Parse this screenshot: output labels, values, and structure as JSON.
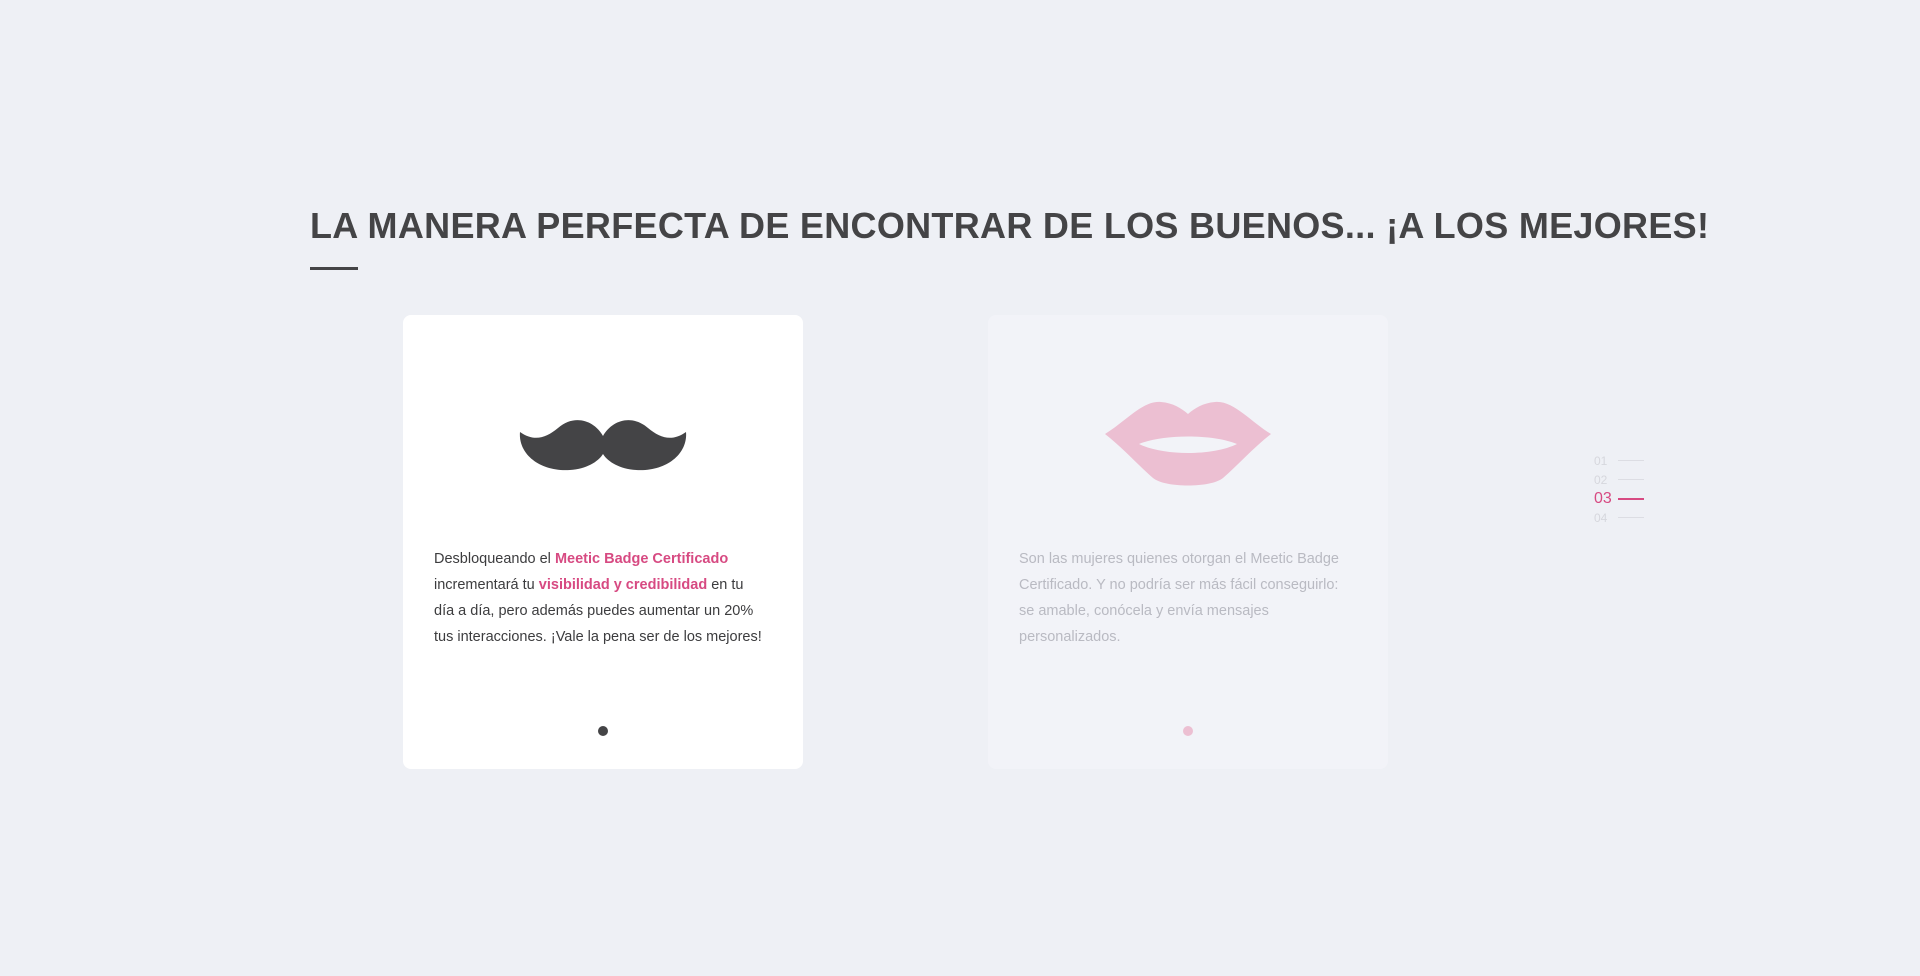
{
  "headline": "LA MANERA PERFECTA DE ENCONTRAR DE LOS BUENOS... ¡A LOS MEJORES!",
  "cards": [
    {
      "icon": "mustache-icon",
      "text_parts": [
        "Desbloqueando el ",
        "Meetic Badge Certificado",
        " incrementará tu ",
        "visibilidad y credibilidad",
        " en tu día a día, pero además puedes aumentar un 20% tus interacciones. ¡Vale la pena ser de los mejores!"
      ],
      "colors": {
        "text": "#3c3c3e",
        "highlight": "#d74a82",
        "icon": "#444446"
      }
    },
    {
      "icon": "lips-icon",
      "text": "Son las mujeres quienes otorgan el Meetic Badge Certificado. Y no podría ser más fácil conseguirlo: se amable, conócela y envía mensajes personalizados.",
      "colors": {
        "text": "#b9bac2",
        "icon": "#ecbfd2"
      }
    }
  ],
  "pager": {
    "items": [
      "01",
      "02",
      "03",
      "04"
    ],
    "active": "03"
  },
  "colors": {
    "background": "#eef0f5",
    "accent": "#d74a82",
    "heading": "#444446"
  }
}
